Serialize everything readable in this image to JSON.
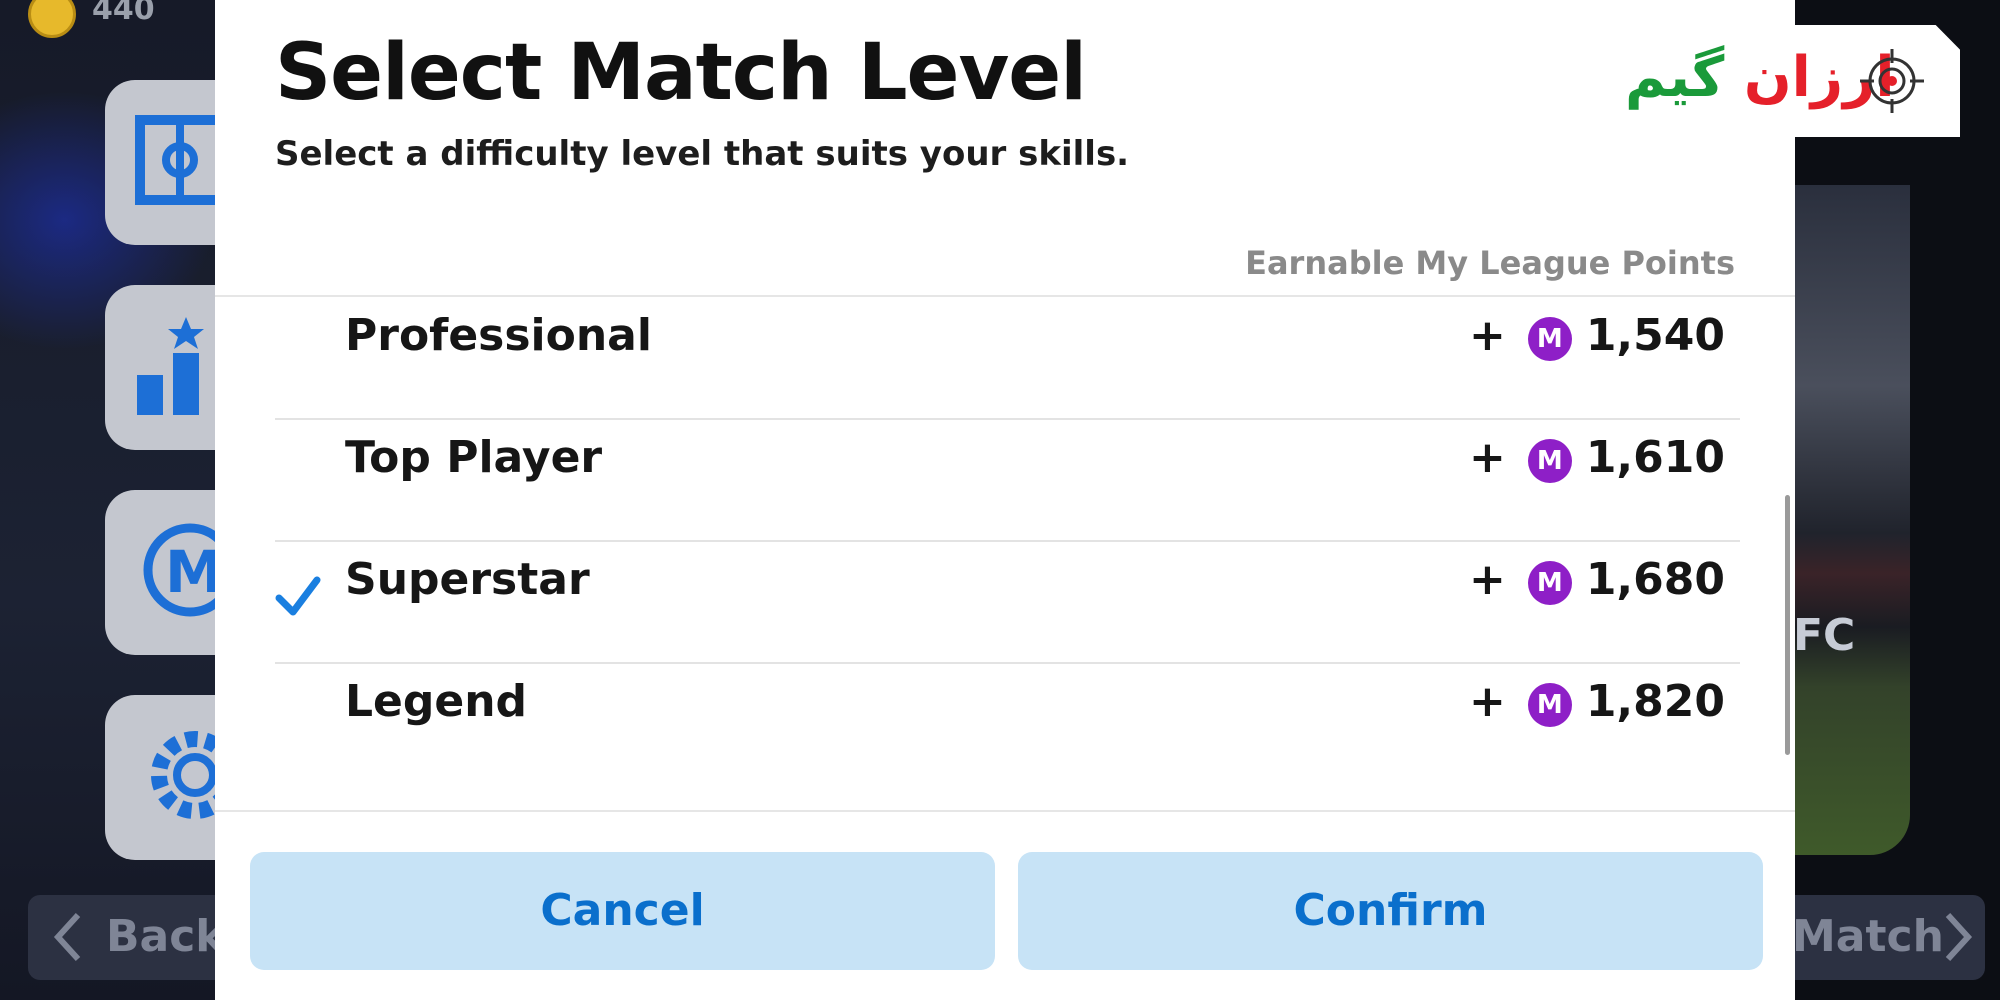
{
  "hud": {
    "coins": "440"
  },
  "dialog": {
    "title": "Select Match Level",
    "subtitle": "Select a difficulty level that suits your skills.",
    "points_header": "Earnable My League Points",
    "levels": [
      {
        "name": "Professional",
        "plus": "+",
        "points": "1,540",
        "selected": false
      },
      {
        "name": "Top Player",
        "plus": "+",
        "points": "1,610",
        "selected": false
      },
      {
        "name": "Superstar",
        "plus": "+",
        "points": "1,680",
        "selected": true
      },
      {
        "name": "Legend",
        "plus": "+",
        "points": "1,820",
        "selected": false
      }
    ],
    "point_icon_letter": "M",
    "cancel_label": "Cancel",
    "confirm_label": "Confirm"
  },
  "background": {
    "back_label": "Back",
    "match_label": "Match",
    "fc_text": "FC"
  },
  "watermark": {
    "word_red": "ارزان",
    "word_green": "گیم"
  },
  "colors": {
    "accent_blue": "#0a6fcc",
    "button_bg": "#c7e3f6",
    "check_blue": "#1a7fe0",
    "point_icon": "#8e1fc7"
  }
}
